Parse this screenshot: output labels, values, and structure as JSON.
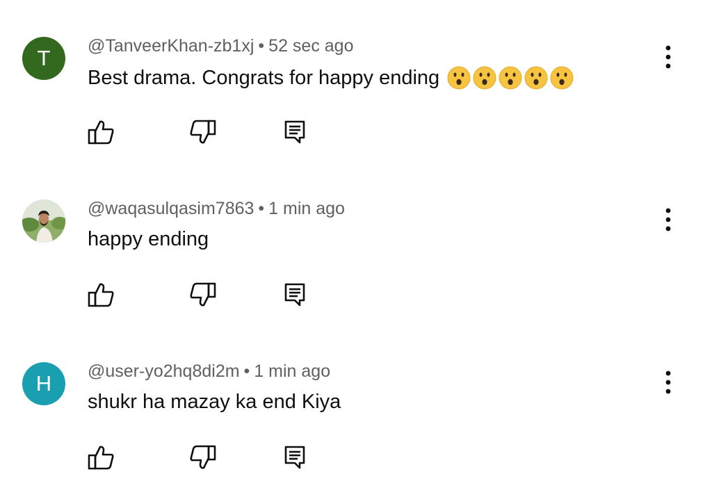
{
  "comments": [
    {
      "author": "@TanveerKhan-zb1xj",
      "time": "52 sec ago",
      "text": "Best drama. Congrats for happy ending",
      "avatar": {
        "type": "letter",
        "letter": "T",
        "color": "#33691e"
      },
      "emojis": [
        "hushed-face-emoji",
        "hushed-face-emoji",
        "hushed-face-emoji",
        "hushed-face-emoji",
        "hushed-face-emoji"
      ]
    },
    {
      "author": "@waqasulqasim7863",
      "time": "1 min ago",
      "text": "happy ending",
      "avatar": {
        "type": "photo"
      }
    },
    {
      "author": "@user-yo2hq8di2m",
      "time": "1 min ago",
      "text": "shukr ha mazay ka end Kiya",
      "avatar": {
        "type": "letter",
        "letter": "H",
        "color": "#1a9fb0"
      }
    }
  ],
  "separator": "•",
  "icons": {
    "like": "thumbs-up-icon",
    "dislike": "thumbs-down-icon",
    "reply": "reply-comment-icon",
    "more": "more-vertical-icon"
  },
  "colors": {
    "meta_text": "#606060",
    "body_text": "#0f0f0f",
    "icon": "#0f0f0f"
  }
}
